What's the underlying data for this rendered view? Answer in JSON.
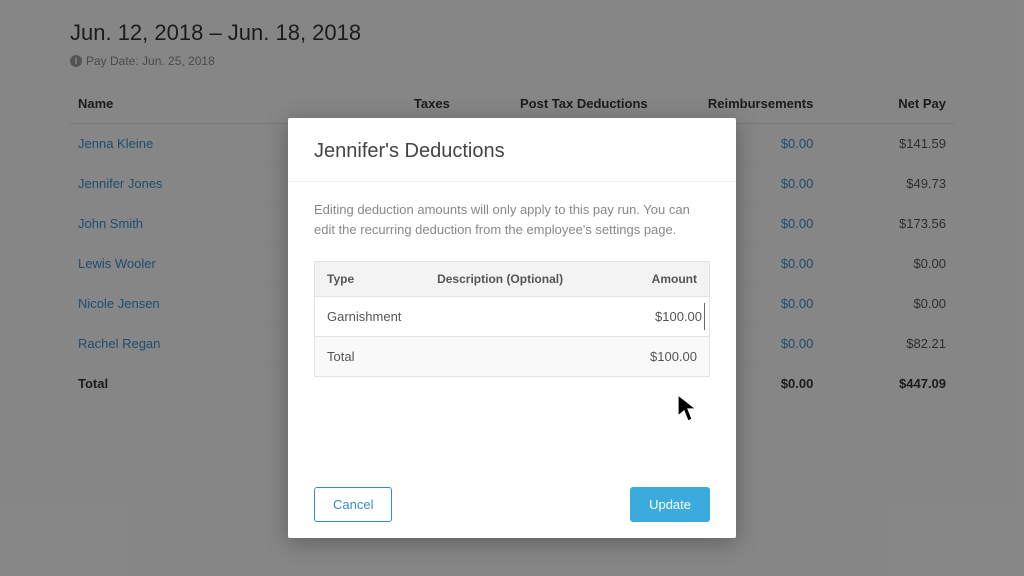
{
  "header": {
    "date_range": "Jun. 12, 2018 – Jun. 18, 2018",
    "pay_date_label": "Pay Date: Jun. 25, 2018"
  },
  "table": {
    "cols": {
      "name": "Name",
      "taxes": "Taxes",
      "post_tax": "Post Tax Deductions",
      "reimb": "Reimbursements",
      "net": "Net Pay"
    },
    "rows": [
      {
        "name": "Jenna Kleine",
        "reimb": "$0.00",
        "net": "$141.59"
      },
      {
        "name": "Jennifer Jones",
        "reimb": "$0.00",
        "net": "$49.73"
      },
      {
        "name": "John Smith",
        "reimb": "$0.00",
        "net": "$173.56"
      },
      {
        "name": "Lewis Wooler",
        "reimb": "$0.00",
        "net": "$0.00"
      },
      {
        "name": "Nicole Jensen",
        "reimb": "$0.00",
        "net": "$0.00"
      },
      {
        "name": "Rachel Regan",
        "reimb": "$0.00",
        "net": "$82.21"
      }
    ],
    "total": {
      "label": "Total",
      "reimb": "$0.00",
      "net": "$447.09"
    }
  },
  "modal": {
    "title": "Jennifer's Deductions",
    "description": "Editing deduction amounts will only apply to this pay run. You can edit the recurring deduction from the employee's settings page.",
    "cols": {
      "type": "Type",
      "desc": "Description (Optional)",
      "amount": "Amount"
    },
    "row": {
      "type": "Garnishment",
      "desc": "",
      "amount": "$100.00"
    },
    "total": {
      "label": "Total",
      "amount": "$100.00"
    },
    "cancel": "Cancel",
    "update": "Update"
  }
}
